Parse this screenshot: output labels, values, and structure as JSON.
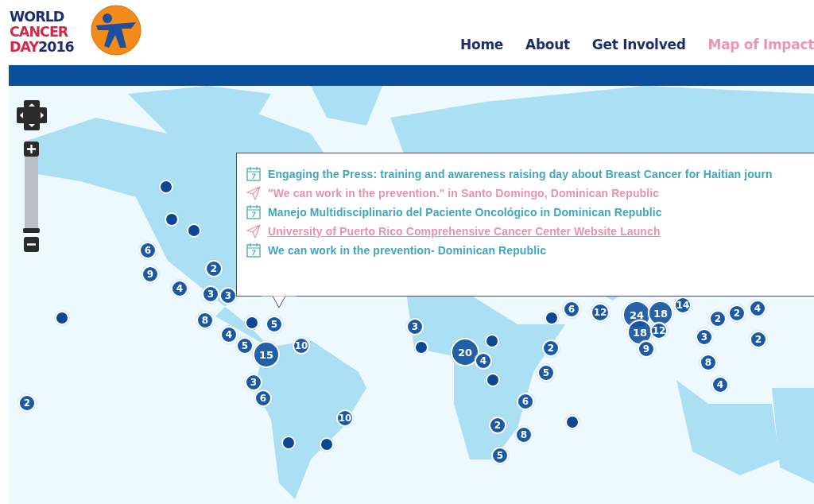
{
  "logo": {
    "lines": [
      {
        "text": "WORLD",
        "kind": "primary"
      },
      {
        "text": "CANCER",
        "kind": "accent"
      }
    ],
    "last": [
      {
        "text": "DAY",
        "kind": "accent"
      },
      {
        "text": "2016",
        "kind": "primary"
      }
    ]
  },
  "nav": [
    {
      "label": "Home",
      "selected": false
    },
    {
      "label": "About",
      "selected": false
    },
    {
      "label": "Get Involved",
      "selected": false
    },
    {
      "label": "Map of Impact",
      "selected": true
    }
  ],
  "zoom": {
    "level": 0
  },
  "popup": {
    "items": [
      {
        "kind": "event",
        "text": "Engaging the Press: training and awareness raising day about Breast Cancer for Haitian journ",
        "hovered": false
      },
      {
        "kind": "story",
        "text": "\"We can work in the prevention.\" in Santo Domingo, Dominican Republic",
        "hovered": false
      },
      {
        "kind": "event",
        "text": "Manejo Multidisciplinario del Paciente Oncológico in Dominican Republic",
        "hovered": false
      },
      {
        "kind": "story",
        "text": "University of Puerto Rico Comprehensive Cancer Center Website Launch",
        "hovered": true
      },
      {
        "kind": "event",
        "text": "We can work in the prevention- Dominican Republic",
        "hovered": false
      }
    ]
  },
  "markers": [
    {
      "kind": "dot"
    },
    {
      "kind": "dot"
    },
    {
      "kind": "dot"
    },
    {
      "kind": "dot"
    },
    {
      "kind": "dot"
    },
    {
      "kind": "dot"
    },
    {
      "kind": "dot"
    },
    {
      "kind": "dot"
    },
    {
      "kind": "dot"
    },
    {
      "kind": "dot"
    },
    {
      "kind": "dot"
    },
    {
      "kind": "dot"
    },
    {
      "kind": "cluster",
      "count": "6"
    },
    {
      "kind": "cluster",
      "count": "9"
    },
    {
      "kind": "cluster",
      "count": "2"
    },
    {
      "kind": "cluster",
      "count": "4"
    },
    {
      "kind": "cluster",
      "count": "3"
    },
    {
      "kind": "cluster",
      "count": "3"
    },
    {
      "kind": "cluster",
      "count": "8"
    },
    {
      "kind": "cluster",
      "count": "4"
    },
    {
      "kind": "cluster",
      "count": "5"
    },
    {
      "kind": "cluster",
      "count": "5"
    },
    {
      "kind": "cluster",
      "count": "15"
    },
    {
      "kind": "cluster",
      "count": "10"
    },
    {
      "kind": "cluster",
      "count": "3"
    },
    {
      "kind": "cluster",
      "count": "6"
    },
    {
      "kind": "cluster",
      "count": "2"
    },
    {
      "kind": "cluster",
      "count": "10"
    },
    {
      "kind": "cluster",
      "count": "3"
    },
    {
      "kind": "cluster",
      "count": "20"
    },
    {
      "kind": "cluster",
      "count": "4"
    },
    {
      "kind": "cluster",
      "count": "2"
    },
    {
      "kind": "cluster",
      "count": "5"
    },
    {
      "kind": "cluster",
      "count": "6"
    },
    {
      "kind": "cluster",
      "count": "2"
    },
    {
      "kind": "cluster",
      "count": "8"
    },
    {
      "kind": "cluster",
      "count": "5"
    },
    {
      "kind": "cluster",
      "count": "6"
    },
    {
      "kind": "cluster",
      "count": "12"
    },
    {
      "kind": "cluster",
      "count": "14"
    },
    {
      "kind": "cluster",
      "count": "24"
    },
    {
      "kind": "cluster",
      "count": "18"
    },
    {
      "kind": "cluster",
      "count": "18"
    },
    {
      "kind": "cluster",
      "count": "12"
    },
    {
      "kind": "cluster",
      "count": "9"
    },
    {
      "kind": "cluster",
      "count": "2"
    },
    {
      "kind": "cluster",
      "count": "2"
    },
    {
      "kind": "cluster",
      "count": "4"
    },
    {
      "kind": "cluster",
      "count": "3"
    },
    {
      "kind": "cluster",
      "count": "2"
    },
    {
      "kind": "cluster",
      "count": "8"
    },
    {
      "kind": "cluster",
      "count": "4"
    }
  ]
}
